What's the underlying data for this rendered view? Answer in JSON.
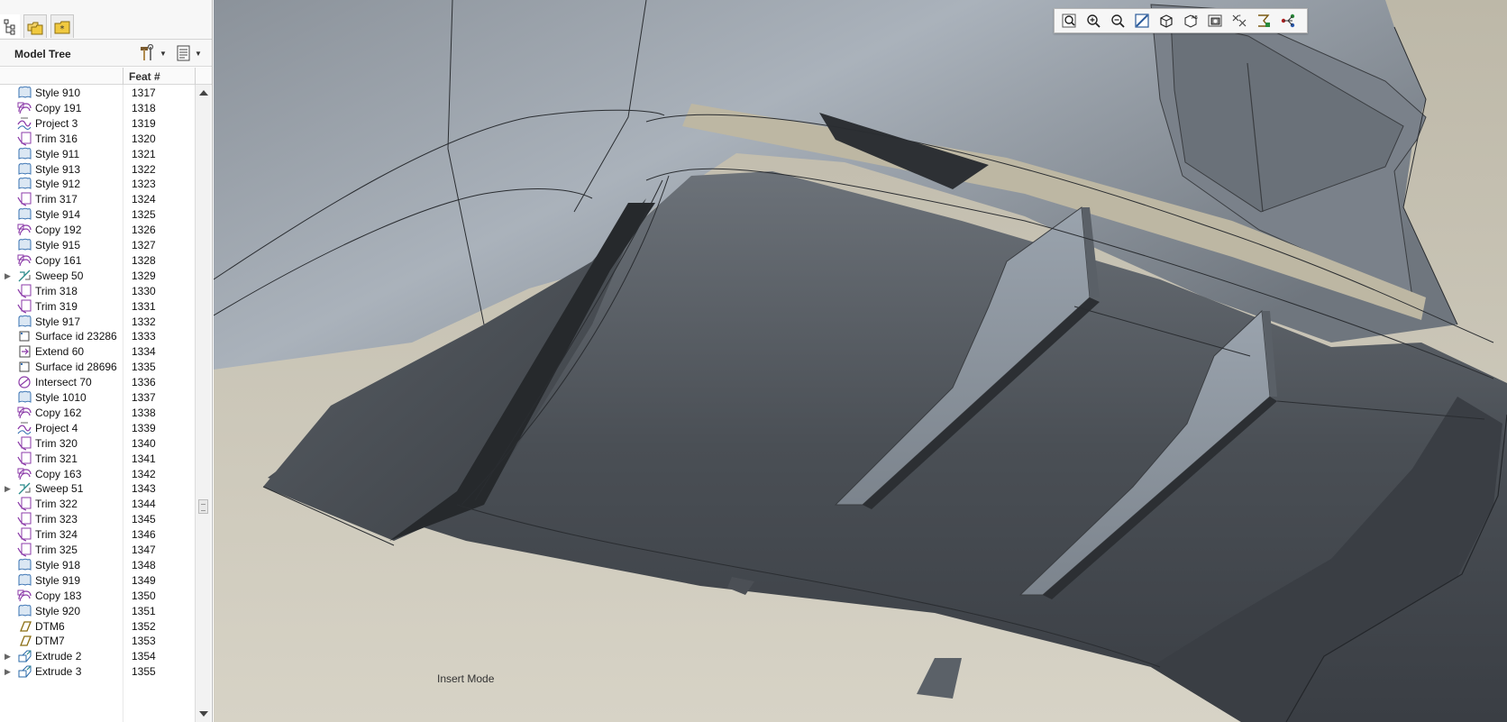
{
  "left_panel": {
    "tabs": [
      {
        "name": "model-tree-tab",
        "icon": "tree-icon"
      },
      {
        "name": "folder-browser-tab",
        "icon": "folders-icon"
      },
      {
        "name": "favorites-tab",
        "icon": "favorites-folder-icon"
      }
    ],
    "tree": {
      "title": "Model Tree",
      "tools": [
        {
          "name": "settings-tool",
          "icon": "hammer-wrench-icon"
        },
        {
          "name": "show-tool",
          "icon": "list-icon"
        }
      ],
      "column_header": "Feat #",
      "items": [
        {
          "name": "Style 910",
          "num": "1317",
          "type": "style",
          "expandable": false
        },
        {
          "name": "Copy 191",
          "num": "1318",
          "type": "copy",
          "expandable": false
        },
        {
          "name": "Project 3",
          "num": "1319",
          "type": "project",
          "expandable": false
        },
        {
          "name": "Trim 316",
          "num": "1320",
          "type": "trim",
          "expandable": false
        },
        {
          "name": "Style 911",
          "num": "1321",
          "type": "style",
          "expandable": false
        },
        {
          "name": "Style 913",
          "num": "1322",
          "type": "style",
          "expandable": false
        },
        {
          "name": "Style 912",
          "num": "1323",
          "type": "style",
          "expandable": false
        },
        {
          "name": "Trim 317",
          "num": "1324",
          "type": "trim",
          "expandable": false
        },
        {
          "name": "Style 914",
          "num": "1325",
          "type": "style",
          "expandable": false
        },
        {
          "name": "Copy 192",
          "num": "1326",
          "type": "copy",
          "expandable": false
        },
        {
          "name": "Style 915",
          "num": "1327",
          "type": "style",
          "expandable": false
        },
        {
          "name": "Copy 161",
          "num": "1328",
          "type": "copy",
          "expandable": false
        },
        {
          "name": "Sweep 50",
          "num": "1329",
          "type": "sweep",
          "expandable": true
        },
        {
          "name": "Trim 318",
          "num": "1330",
          "type": "trim",
          "expandable": false
        },
        {
          "name": "Trim 319",
          "num": "1331",
          "type": "trim",
          "expandable": false
        },
        {
          "name": "Style 917",
          "num": "1332",
          "type": "style",
          "expandable": false
        },
        {
          "name": "Surface id 23286",
          "num": "1333",
          "type": "surface",
          "expandable": false
        },
        {
          "name": "Extend 60",
          "num": "1334",
          "type": "extend",
          "expandable": false
        },
        {
          "name": "Surface id 28696",
          "num": "1335",
          "type": "surface",
          "expandable": false
        },
        {
          "name": "Intersect 70",
          "num": "1336",
          "type": "intersect",
          "expandable": false
        },
        {
          "name": "Style 1010",
          "num": "1337",
          "type": "style",
          "expandable": false
        },
        {
          "name": "Copy 162",
          "num": "1338",
          "type": "copy",
          "expandable": false
        },
        {
          "name": "Project 4",
          "num": "1339",
          "type": "project",
          "expandable": false
        },
        {
          "name": "Trim 320",
          "num": "1340",
          "type": "trim",
          "expandable": false
        },
        {
          "name": "Trim 321",
          "num": "1341",
          "type": "trim",
          "expandable": false
        },
        {
          "name": "Copy 163",
          "num": "1342",
          "type": "copy",
          "expandable": false
        },
        {
          "name": "Sweep 51",
          "num": "1343",
          "type": "sweep",
          "expandable": true
        },
        {
          "name": "Trim 322",
          "num": "1344",
          "type": "trim",
          "expandable": false
        },
        {
          "name": "Trim 323",
          "num": "1345",
          "type": "trim",
          "expandable": false
        },
        {
          "name": "Trim 324",
          "num": "1346",
          "type": "trim",
          "expandable": false
        },
        {
          "name": "Trim 325",
          "num": "1347",
          "type": "trim",
          "expandable": false
        },
        {
          "name": "Style 918",
          "num": "1348",
          "type": "style",
          "expandable": false
        },
        {
          "name": "Style 919",
          "num": "1349",
          "type": "style",
          "expandable": false
        },
        {
          "name": "Copy 183",
          "num": "1350",
          "type": "copy",
          "expandable": false
        },
        {
          "name": "Style 920",
          "num": "1351",
          "type": "style",
          "expandable": false
        },
        {
          "name": "DTM6",
          "num": "1352",
          "type": "datum",
          "expandable": false
        },
        {
          "name": "DTM7",
          "num": "1353",
          "type": "datum",
          "expandable": false
        },
        {
          "name": "Extrude 2",
          "num": "1354",
          "type": "extrude",
          "expandable": true
        },
        {
          "name": "Extrude 3",
          "num": "1355",
          "type": "extrude",
          "expandable": true
        }
      ]
    }
  },
  "viewport": {
    "toolbar": [
      {
        "name": "refit-button",
        "icon": "refit-icon"
      },
      {
        "name": "zoom-in-button",
        "icon": "zoom-in-icon"
      },
      {
        "name": "zoom-out-button",
        "icon": "zoom-out-icon"
      },
      {
        "name": "repaint-button",
        "icon": "repaint-icon"
      },
      {
        "name": "display-style-button",
        "icon": "cube-icon"
      },
      {
        "name": "saved-views-button",
        "icon": "saved-views-icon"
      },
      {
        "name": "view-manager-button",
        "icon": "camera-icon"
      },
      {
        "name": "datum-display-button",
        "icon": "datum-display-icon"
      },
      {
        "name": "annotation-display-button",
        "icon": "annotation-icon"
      },
      {
        "name": "spin-center-button",
        "icon": "spin-center-icon"
      }
    ],
    "status": "Insert Mode",
    "colors": {
      "background": "#c9c4b6",
      "surface_light": "#9aa2ab",
      "surface_dark": "#3c4046"
    }
  }
}
